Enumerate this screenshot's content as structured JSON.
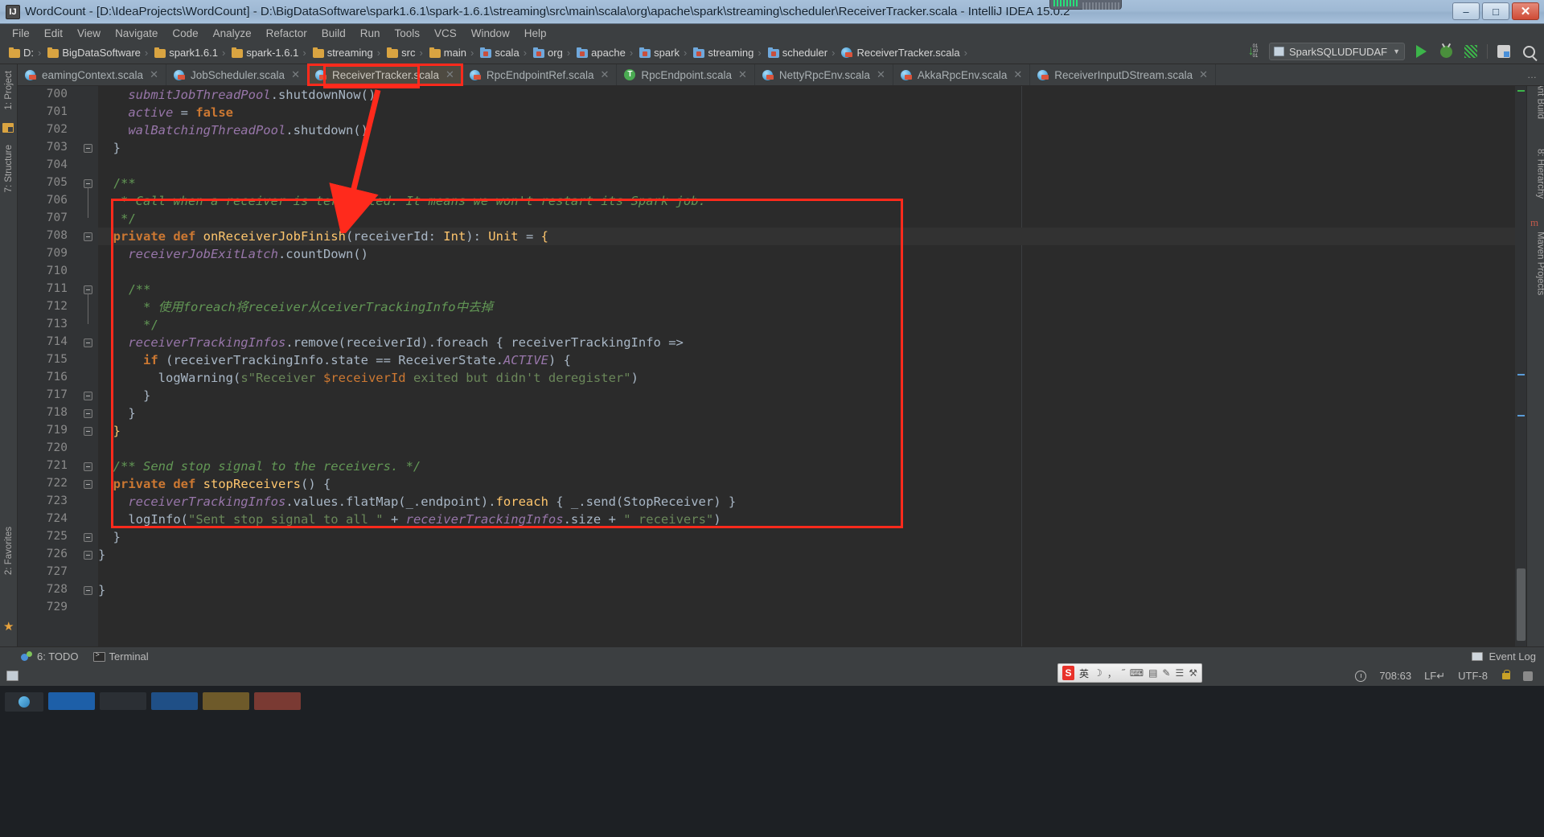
{
  "window": {
    "title": "WordCount - [D:\\IdeaProjects\\WordCount] - D:\\BigDataSoftware\\spark1.6.1\\spark-1.6.1\\streaming\\src\\main\\scala\\org\\apache\\spark\\streaming\\scheduler\\ReceiverTracker.scala - IntelliJ IDEA 15.0.2",
    "app_icon": "IJ",
    "minimize": "–",
    "maximize": "□",
    "close": "✕"
  },
  "menubar": {
    "items": [
      {
        "label": "File"
      },
      {
        "label": "Edit"
      },
      {
        "label": "View"
      },
      {
        "label": "Navigate"
      },
      {
        "label": "Code"
      },
      {
        "label": "Analyze"
      },
      {
        "label": "Refactor"
      },
      {
        "label": "Build"
      },
      {
        "label": "Run"
      },
      {
        "label": "Tools"
      },
      {
        "label": "VCS"
      },
      {
        "label": "Window"
      },
      {
        "label": "Help"
      }
    ]
  },
  "navbar": {
    "breadcrumbs": [
      {
        "label": "D:",
        "icon": "folder-icon",
        "kind": "folder"
      },
      {
        "label": "BigDataSoftware",
        "icon": "folder-icon",
        "kind": "folder"
      },
      {
        "label": "spark1.6.1",
        "icon": "folder-icon",
        "kind": "folder"
      },
      {
        "label": "spark-1.6.1",
        "icon": "folder-icon",
        "kind": "folder"
      },
      {
        "label": "streaming",
        "icon": "folder-icon",
        "kind": "folder"
      },
      {
        "label": "src",
        "icon": "folder-icon",
        "kind": "folder"
      },
      {
        "label": "main",
        "icon": "folder-icon",
        "kind": "folder"
      },
      {
        "label": "scala",
        "icon": "source-folder-icon",
        "kind": "srcfolder"
      },
      {
        "label": "org",
        "icon": "source-folder-icon",
        "kind": "srcfolder"
      },
      {
        "label": "apache",
        "icon": "source-folder-icon",
        "kind": "srcfolder"
      },
      {
        "label": "spark",
        "icon": "source-folder-icon",
        "kind": "srcfolder"
      },
      {
        "label": "streaming",
        "icon": "source-folder-icon",
        "kind": "srcfolder"
      },
      {
        "label": "scheduler",
        "icon": "source-folder-icon",
        "kind": "srcfolder"
      },
      {
        "label": "ReceiverTracker.scala",
        "icon": "scala-class-icon",
        "kind": "scala"
      }
    ],
    "separator": "›",
    "run_config": {
      "label": "SparkSQLUDFUDAF",
      "chevron": "▼"
    },
    "actions": [
      {
        "name": "sort-lines-icon",
        "label": "01 10"
      },
      {
        "name": "run-icon"
      },
      {
        "name": "debug-icon"
      },
      {
        "name": "run-with-coverage-icon"
      },
      {
        "name": "project-structure-icon"
      },
      {
        "name": "search-everywhere-icon"
      }
    ]
  },
  "tabs": {
    "items": [
      {
        "label": "eamingContext.scala",
        "icon": "scala-class-icon",
        "active": false,
        "highlighted": false,
        "close": "✕"
      },
      {
        "label": "JobScheduler.scala",
        "icon": "scala-class-icon",
        "active": false,
        "highlighted": false,
        "close": "✕"
      },
      {
        "label": "ReceiverTracker.scala",
        "icon": "scala-class-icon",
        "active": true,
        "highlighted": true,
        "close": "✕"
      },
      {
        "label": "RpcEndpointRef.scala",
        "icon": "scala-class-icon",
        "active": false,
        "highlighted": false,
        "close": "✕"
      },
      {
        "label": "RpcEndpoint.scala",
        "icon": "scala-trait-icon",
        "active": false,
        "highlighted": false,
        "close": "✕"
      },
      {
        "label": "NettyRpcEnv.scala",
        "icon": "scala-class-icon",
        "active": false,
        "highlighted": false,
        "close": "✕"
      },
      {
        "label": "AkkaRpcEnv.scala",
        "icon": "scala-class-icon",
        "active": false,
        "highlighted": false,
        "close": "✕"
      },
      {
        "label": "ReceiverInputDStream.scala",
        "icon": "scala-class-icon",
        "active": false,
        "highlighted": false,
        "close": "✕"
      }
    ],
    "overflow": "…"
  },
  "left_tool_window": {
    "items": [
      {
        "label": "1: Project",
        "name": "tool-window-project"
      },
      {
        "label": "7: Structure",
        "name": "tool-window-structure"
      },
      {
        "label": "2: Favorites",
        "name": "tool-window-favorites"
      }
    ]
  },
  "right_tool_window": {
    "items": [
      {
        "label": "Ant Build",
        "name": "tool-window-ant-build"
      },
      {
        "label": "8: Hierarchy",
        "name": "tool-window-hierarchy"
      },
      {
        "label": "Maven Projects",
        "name": "tool-window-maven-projects"
      }
    ]
  },
  "editor": {
    "first_line": 700,
    "caret_line": 708,
    "lines": [
      {
        "n": 700,
        "tokens": [
          {
            "t": "    ",
            "c": "pln"
          },
          {
            "t": "submitJobThreadPool",
            "c": "fld"
          },
          {
            "t": ".shutdownNow()",
            "c": "pln"
          }
        ]
      },
      {
        "n": 701,
        "tokens": [
          {
            "t": "    ",
            "c": "pln"
          },
          {
            "t": "active",
            "c": "fld"
          },
          {
            "t": " = ",
            "c": "pln"
          },
          {
            "t": "false",
            "c": "kw"
          }
        ]
      },
      {
        "n": 702,
        "tokens": [
          {
            "t": "    ",
            "c": "pln"
          },
          {
            "t": "walBatchingThreadPool",
            "c": "fld"
          },
          {
            "t": ".shutdown()",
            "c": "pln"
          }
        ]
      },
      {
        "n": 703,
        "tokens": [
          {
            "t": "  }",
            "c": "pln"
          }
        ]
      },
      {
        "n": 704,
        "tokens": [
          {
            "t": "",
            "c": "pln"
          }
        ]
      },
      {
        "n": 705,
        "tokens": [
          {
            "t": "  /**",
            "c": "cmtb"
          }
        ]
      },
      {
        "n": 706,
        "tokens": [
          {
            "t": "   * Call when a receiver is terminated. It means we won't restart its Spark job.",
            "c": "cmt"
          }
        ]
      },
      {
        "n": 707,
        "tokens": [
          {
            "t": "   */",
            "c": "cmtb"
          }
        ]
      },
      {
        "n": 708,
        "tokens": [
          {
            "t": "  ",
            "c": "pln"
          },
          {
            "t": "private def ",
            "c": "kw"
          },
          {
            "t": "onReceiverJobFinish",
            "c": "fn"
          },
          {
            "t": "(receiverId: ",
            "c": "pln"
          },
          {
            "t": "Int",
            "c": "fn"
          },
          {
            "t": "): ",
            "c": "pln"
          },
          {
            "t": "Unit",
            "c": "fn"
          },
          {
            "t": " = ",
            "c": "pln"
          },
          {
            "t": "{",
            "c": "brcY"
          }
        ]
      },
      {
        "n": 709,
        "tokens": [
          {
            "t": "    ",
            "c": "pln"
          },
          {
            "t": "receiverJobExitLatch",
            "c": "fld"
          },
          {
            "t": ".countDown()",
            "c": "pln"
          }
        ]
      },
      {
        "n": 710,
        "tokens": [
          {
            "t": "",
            "c": "pln"
          }
        ]
      },
      {
        "n": 711,
        "tokens": [
          {
            "t": "    /**",
            "c": "cmtb"
          }
        ]
      },
      {
        "n": 712,
        "tokens": [
          {
            "t": "      * 使用foreach将receiver从ceiverTrackingInfo中去掉",
            "c": "cmt"
          }
        ]
      },
      {
        "n": 713,
        "tokens": [
          {
            "t": "      */",
            "c": "cmtb"
          }
        ]
      },
      {
        "n": 714,
        "tokens": [
          {
            "t": "    ",
            "c": "pln"
          },
          {
            "t": "receiverTrackingInfos",
            "c": "fld"
          },
          {
            "t": ".remove(receiverId).foreach { receiverTrackingInfo =>",
            "c": "pln"
          }
        ]
      },
      {
        "n": 715,
        "tokens": [
          {
            "t": "      ",
            "c": "pln"
          },
          {
            "t": "if",
            "c": "kw"
          },
          {
            "t": " (receiverTrackingInfo.state == ReceiverState.",
            "c": "pln"
          },
          {
            "t": "ACTIVE",
            "c": "stc"
          },
          {
            "t": ") {",
            "c": "pln"
          }
        ]
      },
      {
        "n": 716,
        "tokens": [
          {
            "t": "        logWarning(",
            "c": "pln"
          },
          {
            "t": "s\"Receiver ",
            "c": "str"
          },
          {
            "t": "$receiverId",
            "c": "esc"
          },
          {
            "t": " exited but didn't deregister\"",
            "c": "str"
          },
          {
            "t": ")",
            "c": "pln"
          }
        ]
      },
      {
        "n": 717,
        "tokens": [
          {
            "t": "      }",
            "c": "pln"
          }
        ]
      },
      {
        "n": 718,
        "tokens": [
          {
            "t": "    }",
            "c": "pln"
          }
        ]
      },
      {
        "n": 719,
        "tokens": [
          {
            "t": "  ",
            "c": "pln"
          },
          {
            "t": "}",
            "c": "brcY"
          }
        ]
      },
      {
        "n": 720,
        "tokens": [
          {
            "t": "",
            "c": "pln"
          }
        ]
      },
      {
        "n": 721,
        "tokens": [
          {
            "t": "  /** Send stop signal to the receivers. */",
            "c": "cmt"
          }
        ]
      },
      {
        "n": 722,
        "tokens": [
          {
            "t": "  ",
            "c": "pln"
          },
          {
            "t": "private def ",
            "c": "kw"
          },
          {
            "t": "stopReceivers",
            "c": "fn"
          },
          {
            "t": "() {",
            "c": "pln"
          }
        ]
      },
      {
        "n": 723,
        "tokens": [
          {
            "t": "    ",
            "c": "pln"
          },
          {
            "t": "receiverTrackingInfos",
            "c": "fld"
          },
          {
            "t": ".values.flatMap(_.endpoint).",
            "c": "pln"
          },
          {
            "t": "foreach",
            "c": "fn"
          },
          {
            "t": " { _.send(StopReceiver) }",
            "c": "pln"
          }
        ]
      },
      {
        "n": 724,
        "tokens": [
          {
            "t": "    logInfo(",
            "c": "pln"
          },
          {
            "t": "\"Sent stop signal to all \"",
            "c": "str"
          },
          {
            "t": " + ",
            "c": "pln"
          },
          {
            "t": "receiverTrackingInfos",
            "c": "fld"
          },
          {
            "t": ".size + ",
            "c": "pln"
          },
          {
            "t": "\" receivers\"",
            "c": "str"
          },
          {
            "t": ")",
            "c": "pln"
          }
        ]
      },
      {
        "n": 725,
        "tokens": [
          {
            "t": "  }",
            "c": "pln"
          }
        ]
      },
      {
        "n": 726,
        "tokens": [
          {
            "t": "}",
            "c": "pln"
          }
        ]
      },
      {
        "n": 727,
        "tokens": [
          {
            "t": "",
            "c": "pln"
          }
        ]
      },
      {
        "n": 728,
        "tokens": [
          {
            "t": "}",
            "c": "pln"
          }
        ]
      },
      {
        "n": 729,
        "tokens": [
          {
            "t": "",
            "c": "pln"
          }
        ]
      }
    ]
  },
  "annotations": {
    "tab_highlight": {
      "label": "ReceiverTracker.scala highlight box",
      "color": "#ff2a1c"
    },
    "code_highlight": {
      "label": "onReceiverJobFinish method highlight box",
      "color": "#ff2a1c"
    },
    "arrow": {
      "label": "arrow from tab to method",
      "color": "#ff2a1c"
    }
  },
  "bottombar": {
    "items": [
      {
        "label": "6: TODO",
        "name": "tool-window-todo"
      },
      {
        "label": "Terminal",
        "name": "tool-window-terminal"
      }
    ],
    "event_log": "Event Log"
  },
  "statusbar": {
    "position": "708:63",
    "line_separator": "LF↵",
    "encoding": "UTF-8",
    "lock": "read-write-toggle",
    "git_branch": ""
  },
  "taskbar": {
    "ime": {
      "sogou": "S",
      "lang": "英",
      "moon": "☽",
      "comma": "，",
      "quote": "˝",
      "kbd": "⌨",
      "box": "▤",
      "pen": "✎",
      "trash": "☰",
      "wrench": "⚒"
    }
  },
  "colors": {
    "titlebar": "#a3bdd7",
    "chrome": "#3c3f41",
    "editor_bg": "#2b2b2b",
    "gutter_bg": "#313335",
    "accent_red": "#ff2a1c",
    "active_tab": "#4e4a41",
    "comment_green": "#629755",
    "keyword_orange": "#cc7832",
    "field_purple": "#9876aa",
    "method_yellow": "#ffc66d",
    "string_green": "#6a8759",
    "text_grey": "#a9b7c6"
  }
}
